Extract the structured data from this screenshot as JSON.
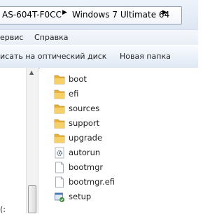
{
  "address": {
    "crumbs": [
      "AS-604T-F0CC",
      "Windows 7 Ultimate 64"
    ]
  },
  "menu": {
    "items": [
      "ервис",
      "Справка"
    ]
  },
  "toolbar": {
    "burn": "исать на оптический диск",
    "new_folder": "Новая папка"
  },
  "nav": {
    "partial_item": "(:"
  },
  "files": [
    {
      "name": "boot",
      "icon": "folder-icon"
    },
    {
      "name": "efi",
      "icon": "folder-icon"
    },
    {
      "name": "sources",
      "icon": "folder-icon"
    },
    {
      "name": "support",
      "icon": "folder-icon"
    },
    {
      "name": "upgrade",
      "icon": "folder-icon"
    },
    {
      "name": "autorun",
      "icon": "settings-file-icon"
    },
    {
      "name": "bootmgr",
      "icon": "file-icon"
    },
    {
      "name": "bootmgr.efi",
      "icon": "file-icon"
    },
    {
      "name": "setup",
      "icon": "setup-icon"
    }
  ],
  "colors": {
    "folder_yellow": "#e8b53c",
    "toolbar_blue": "#dfe8f4",
    "address_border": "#8e9db0"
  }
}
